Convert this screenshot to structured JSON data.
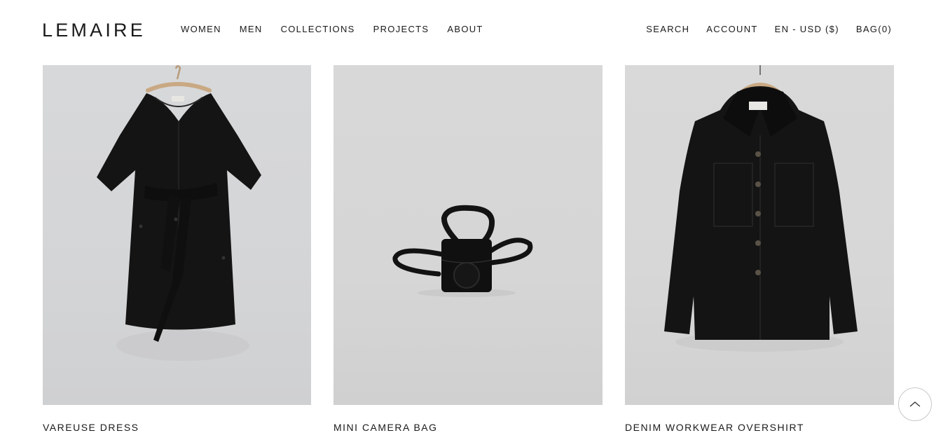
{
  "header": {
    "logo": "LEMAIRE",
    "nav_left": [
      "WOMEN",
      "MEN",
      "COLLECTIONS",
      "PROJECTS",
      "ABOUT"
    ],
    "nav_right": {
      "search": "SEARCH",
      "account": "ACCOUNT",
      "locale": "EN - USD ($)",
      "bag": "BAG(0)"
    }
  },
  "products": [
    {
      "name": "VAREUSE DRESS",
      "image": "black-dress-on-hanger"
    },
    {
      "name": "MINI CAMERA BAG",
      "image": "black-leather-camera-bag"
    },
    {
      "name": "DENIM WORKWEAR OVERSHIRT",
      "image": "black-overshirt-on-hanger"
    }
  ],
  "back_to_top": {
    "icon": "chevron-up-icon"
  },
  "colors": {
    "background": "#ffffff",
    "text": "#1a1a1a",
    "photo_background": "#d8d8d8",
    "garment": "#141414"
  }
}
